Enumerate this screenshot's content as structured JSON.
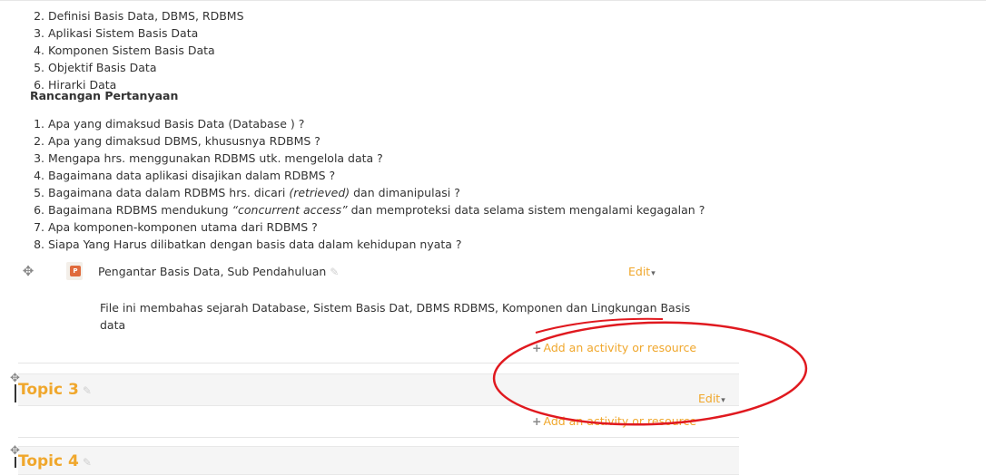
{
  "list_topics": [
    "Definisi Basis Data, DBMS, RDBMS",
    "Aplikasi Sistem Basis Data",
    "Komponen Sistem Basis Data",
    "Objektif Basis Data",
    "Hirarki Data"
  ],
  "questions_heading": "Rancangan  Pertanyaan",
  "questions": [
    {
      "text": "Apa yang dimaksud Basis Data (Database ) ?"
    },
    {
      "text": "Apa yang dimaksud DBMS, khususnya RDBMS ?"
    },
    {
      "text": "Mengapa hrs. menggunakan RDBMS utk. mengelola data ?"
    },
    {
      "text": "Bagaimana data aplikasi disajikan dalam RDBMS ?"
    },
    {
      "pre": "Bagaimana data dalam RDBMS hrs. dicari ",
      "em": "(retrieved)",
      "post": " dan dimanipulasi ?"
    },
    {
      "pre": "Bagaimana RDBMS mendukung ",
      "em": "“concurrent access”",
      "post": " dan memproteksi data selama sistem mengalami kegagalan ?"
    },
    {
      "text": "Apa komponen-komponen utama dari RDBMS ?"
    },
    {
      "text": "Siapa Yang Harus dilibatkan dengan basis data dalam kehidupan nyata ?"
    }
  ],
  "activity": {
    "name": "Pengantar Basis Data, Sub Pendahuluan",
    "icon": "powerpoint-file-icon",
    "icon_badge": "P",
    "edit_label": "Edit",
    "description": "File ini membahas sejarah Database, Sistem Basis Dat, DBMS RDBMS, Komponen dan Lingkungan Basis data"
  },
  "add_activity_label": "Add an activity or resource",
  "topic3": {
    "title": "Topic 3",
    "edit_label": "Edit"
  },
  "topic4": {
    "title": "Topic 4"
  },
  "colors": {
    "accent": "#f0a72c",
    "annotation": "#e0191f"
  }
}
